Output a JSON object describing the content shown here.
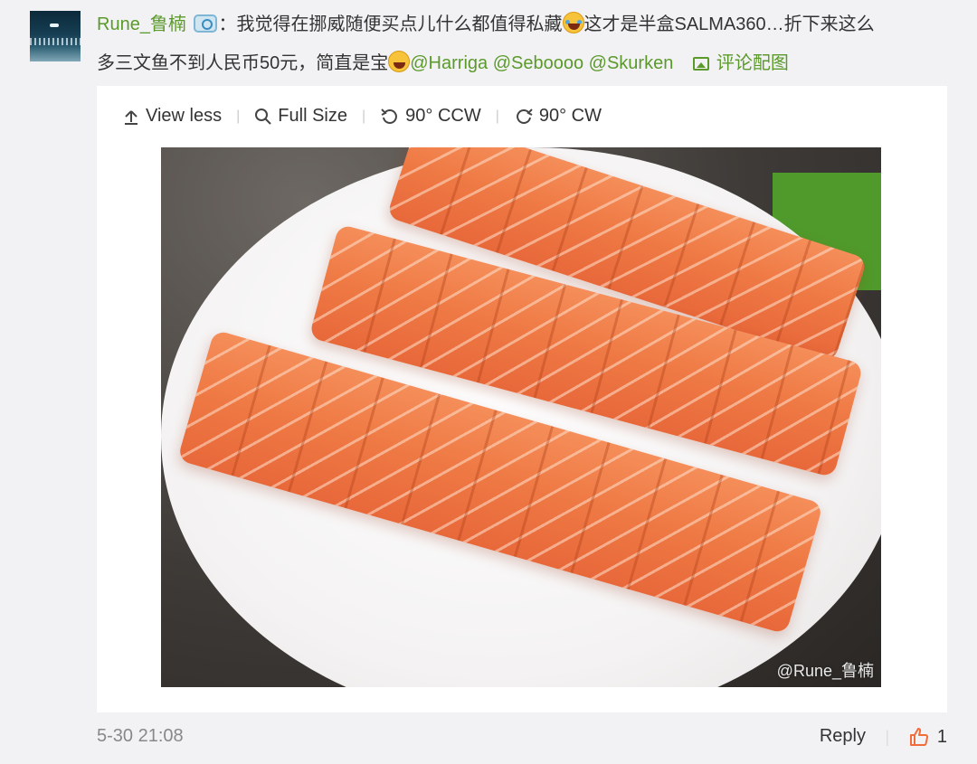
{
  "comment": {
    "username": "Rune_鲁楠",
    "separator": "：",
    "text_part1": "我觉得在挪威随便买点儿什么都值得私藏",
    "text_part2": "这才是半盒SALMA360…折下来这么",
    "text_line2": "多三文鱼不到人民币50元，简直是宝",
    "mentions": [
      "@Harriga",
      "@Seboooo",
      "@Skurken"
    ],
    "view_pic_label": "评论配图"
  },
  "media_toolbar": {
    "view_less": "View less",
    "full_size": "Full Size",
    "rotate_ccw": "90° CCW",
    "rotate_cw": "90° CW"
  },
  "photo": {
    "watermark": "@Rune_鲁楠"
  },
  "footer": {
    "timestamp": "5-30 21:08",
    "reply_label": "Reply",
    "like_count": "1"
  },
  "colors": {
    "mention": "#5b9a2a",
    "background": "#f2f2f5",
    "like_icon": "#f26b3a"
  }
}
